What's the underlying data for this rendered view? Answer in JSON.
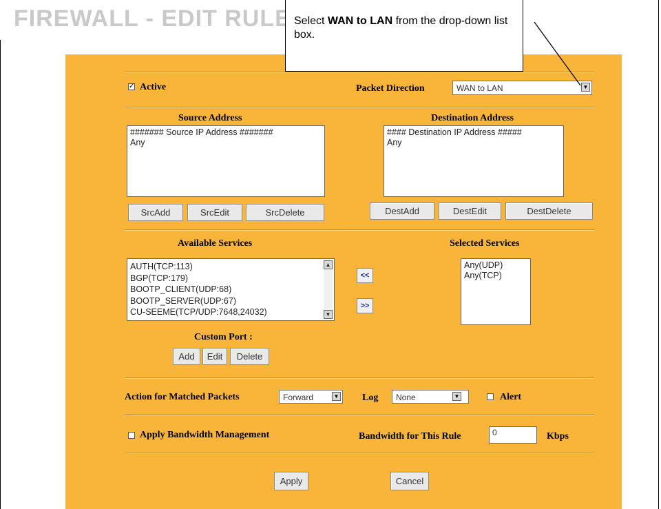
{
  "page_title": "FIREWALL - EDIT RULE",
  "callout": {
    "prefix": "Select ",
    "bold": "WAN to LAN",
    "suffix": " from the drop-down list box."
  },
  "rule": {
    "active_label": "Active",
    "active_checked": true,
    "packet_direction_label": "Packet Direction",
    "packet_direction_value": "WAN to LAN"
  },
  "source": {
    "header": "Source Address",
    "items": [
      "####### Source IP Address #######",
      "Any"
    ],
    "buttons": [
      "SrcAdd",
      "SrcEdit",
      "SrcDelete"
    ]
  },
  "destination": {
    "header": "Destination Address",
    "items": [
      "#### Destination IP Address #####",
      "Any"
    ],
    "buttons": [
      "DestAdd",
      "DestEdit",
      "DestDelete"
    ]
  },
  "services": {
    "available_header": "Available Services",
    "available_items": [
      "AUTH(TCP:113)",
      "BGP(TCP:179)",
      "BOOTP_CLIENT(UDP:68)",
      "BOOTP_SERVER(UDP:67)",
      "CU-SEEME(TCP/UDP:7648,24032)"
    ],
    "selected_header": "Selected Services",
    "selected_items": [
      "Any(UDP)",
      "Any(TCP)"
    ],
    "move_left": "<<",
    "move_right": ">>",
    "custom_port_label": "Custom Port :",
    "custom_buttons": [
      "Add",
      "Edit",
      "Delete"
    ]
  },
  "action": {
    "label": "Action for Matched Packets",
    "value": "Forward",
    "log_label": "Log",
    "log_value": "None",
    "alert_label": "Alert",
    "alert_checked": false
  },
  "bandwidth": {
    "apply_label": "Apply Bandwidth Management",
    "apply_checked": false,
    "rule_label": "Bandwidth for This Rule",
    "rule_value": "0",
    "unit": "Kbps"
  },
  "footer": {
    "apply": "Apply",
    "cancel": "Cancel"
  },
  "colors": {
    "panel": "#f8b53a",
    "title": "#c9c9c9"
  }
}
